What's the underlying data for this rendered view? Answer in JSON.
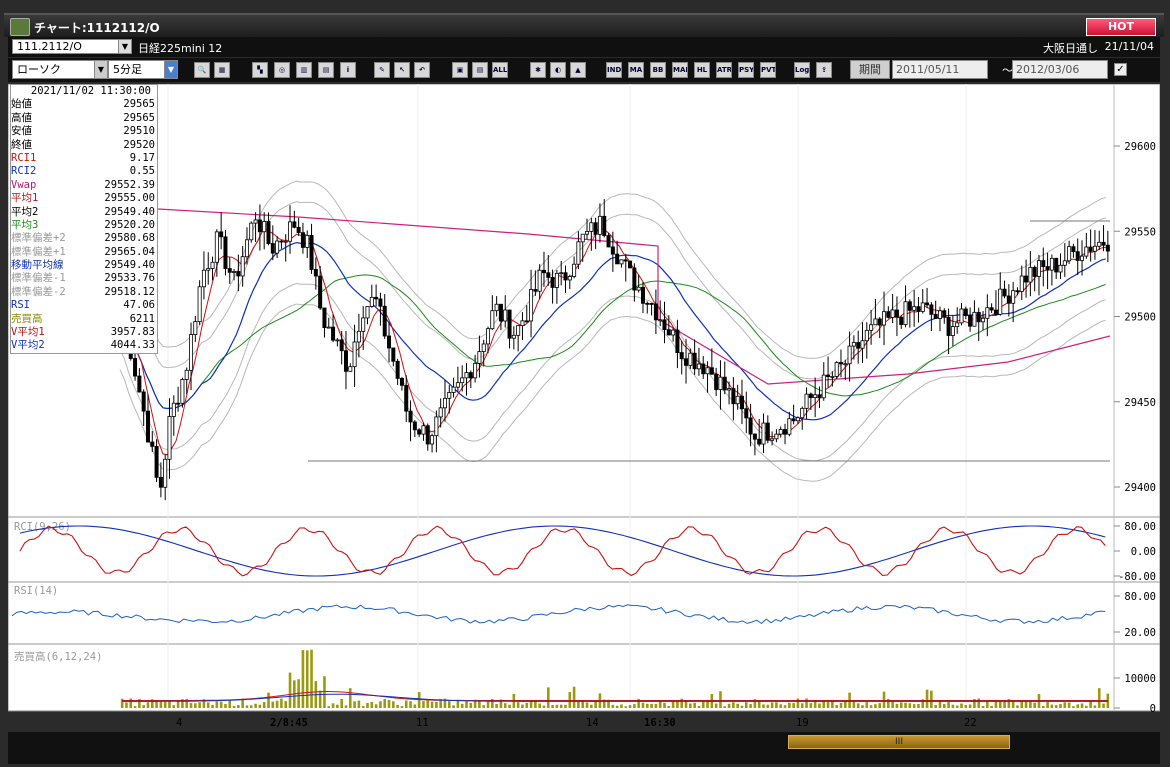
{
  "window": {
    "title": "チャート:1112112/O",
    "hot_label": "HOT"
  },
  "symbol": {
    "code": "111.2112/O",
    "name": "日経225mini 12",
    "market": "大阪日通し",
    "date": "21/11/04"
  },
  "toolbar": {
    "chart_type": "ローソク",
    "interval": "5分足",
    "buttons": [
      "zoom",
      "grid",
      "draw",
      "search",
      "bars",
      "bars2",
      "info",
      "pen",
      "cursor",
      "undo",
      "box",
      "box2",
      "ALL",
      "gear",
      "color",
      "paint",
      "IND",
      "MA",
      "BB",
      "MAE",
      "HL",
      "ATR",
      "PSY",
      "PVT",
      "Log",
      "export"
    ],
    "period_label": "期間",
    "date_from": "2011/05/11",
    "date_to": "2012/03/06",
    "tilde": "～"
  },
  "info_panel": {
    "timestamp": "2021/11/02  11:30:00",
    "rows": [
      {
        "label": "始値",
        "value": "29565",
        "color": "#000000"
      },
      {
        "label": "高値",
        "value": "29565",
        "color": "#000000"
      },
      {
        "label": "安値",
        "value": "29510",
        "color": "#000000"
      },
      {
        "label": "終値",
        "value": "29520",
        "color": "#000000"
      },
      {
        "label": "RCI1",
        "value": "9.17",
        "color": "#d01010"
      },
      {
        "label": "RCI2",
        "value": "0.55",
        "color": "#1030c0"
      },
      {
        "label": "Vwap",
        "value": "29552.39",
        "color": "#c01870"
      },
      {
        "label": "平均1",
        "value": "29555.00",
        "color": "#c01010"
      },
      {
        "label": "平均2",
        "value": "29549.40",
        "color": "#000000"
      },
      {
        "label": "平均3",
        "value": "29520.20",
        "color": "#1a8a1a"
      },
      {
        "label": "標準偏差+2",
        "value": "29580.68",
        "color": "#999999"
      },
      {
        "label": "標準偏差+1",
        "value": "29565.04",
        "color": "#999999"
      },
      {
        "label": "移動平均線",
        "value": "29549.40",
        "color": "#1030c0"
      },
      {
        "label": "標準偏差-1",
        "value": "29533.76",
        "color": "#999999"
      },
      {
        "label": "標準偏差-2",
        "value": "29518.12",
        "color": "#999999"
      },
      {
        "label": "RSI",
        "value": "47.06",
        "color": "#1030c0"
      },
      {
        "label": "売買高",
        "value": "6211",
        "color": "#8a8a00"
      },
      {
        "label": "V平均1",
        "value": "3957.83",
        "color": "#c01010"
      },
      {
        "label": "V平均2",
        "value": "4044.33",
        "color": "#1030c0"
      }
    ]
  },
  "price_axis": {
    "ticks": [
      "29600",
      "29550",
      "29500",
      "29450",
      "29400"
    ]
  },
  "rci_panel": {
    "label": "RCI(9,26)",
    "ticks": [
      "80.00",
      "0.00",
      "-80.00"
    ]
  },
  "rsi_panel": {
    "label": "RSI(14)",
    "ticks": [
      "80.00",
      "20.00"
    ]
  },
  "vol_panel": {
    "label": "売買高(6,12,24)",
    "ticks": [
      "10000",
      "0"
    ]
  },
  "x_labels": [
    "4",
    "2/8:45",
    "11",
    "14",
    "16:30",
    "19",
    "22"
  ],
  "scroll_thumb": "III"
}
